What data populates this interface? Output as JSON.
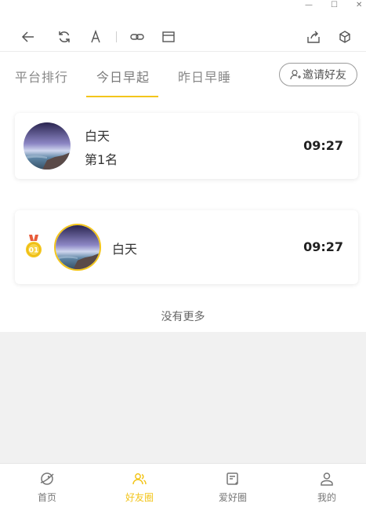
{
  "window": {
    "minimize_glyph": "—",
    "maximize_glyph": "☐",
    "close_glyph": "✕"
  },
  "toolbar": {
    "icons": [
      "back-icon",
      "refresh-icon",
      "font-icon",
      "link-icon",
      "window-icon",
      "share-icon",
      "cube-icon"
    ]
  },
  "tabs": [
    {
      "label": "平台排行",
      "active": false
    },
    {
      "label": "今日早起",
      "active": true
    },
    {
      "label": "昨日早睡",
      "active": false
    }
  ],
  "invite_button": {
    "label": "邀请好友"
  },
  "top_card": {
    "name": "白天",
    "rank": "第1名",
    "time": "09:27"
  },
  "list": [
    {
      "medal": "01",
      "name": "白天",
      "time": "09:27"
    }
  ],
  "no_more": "没有更多",
  "bottom_nav": [
    {
      "label": "首页",
      "icon": "planet-icon",
      "active": false
    },
    {
      "label": "好友圈",
      "icon": "friends-icon",
      "active": true
    },
    {
      "label": "爱好圈",
      "icon": "hobby-icon",
      "active": false
    },
    {
      "label": "我的",
      "icon": "person-icon",
      "active": false
    }
  ],
  "colors": {
    "accent": "#f3c51b",
    "text": "#333333",
    "muted": "#888888",
    "background_gray": "#f1f1f1"
  }
}
